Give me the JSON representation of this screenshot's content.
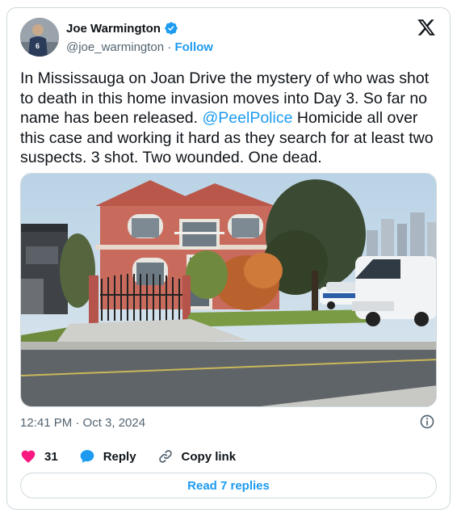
{
  "author": {
    "name": "Joe Warmington",
    "handle": "@joe_warmington",
    "separator": "·",
    "follow_label": "Follow"
  },
  "tweet": {
    "text_part1": "In Mississauga on Joan Drive the mystery of who was shot to death in this home invasion moves into Day 3. So far no name has been released. ",
    "mention": "@PeelPolice",
    "text_part2": " Homicide all over this case and working it hard as they search for at least two suspects. 3 shot. Two wounded. One dead."
  },
  "meta": {
    "timestamp": "12:41 PM · Oct 3, 2024"
  },
  "actions": {
    "likes_count": "31",
    "reply_label": "Reply",
    "copy_link_label": "Copy link"
  },
  "replies_button": "Read 7 replies",
  "icons": {
    "verified": "verified-badge-icon",
    "x_logo": "x-logo-icon",
    "info": "info-icon",
    "heart": "heart-icon",
    "reply": "reply-bubble-icon",
    "link": "link-icon"
  },
  "colors": {
    "accent": "#1d9bf0",
    "heart": "#f91880",
    "text": "#0f1419",
    "secondary": "#536471"
  }
}
